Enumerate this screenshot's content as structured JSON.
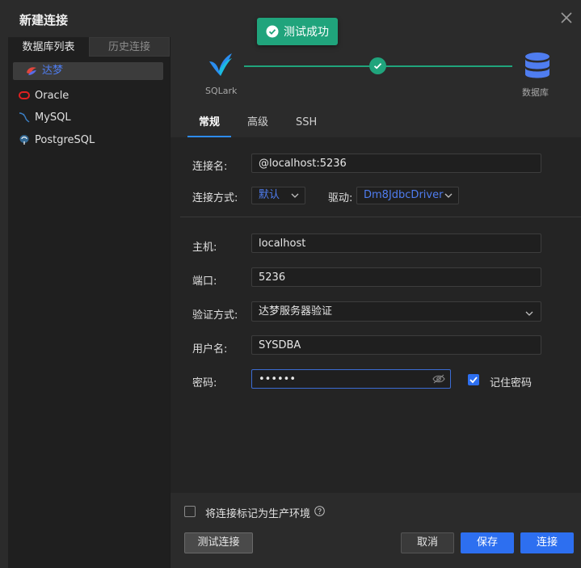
{
  "dialog": {
    "title": "新建连接"
  },
  "toast": {
    "text": "测试成功",
    "color": "#20a47c"
  },
  "left_panel": {
    "tabs": [
      {
        "label": "数据库列表",
        "active": true
      },
      {
        "label": "历史连接",
        "active": false
      }
    ],
    "items": [
      {
        "label": "达梦",
        "icon": "dameng-icon",
        "selected": true
      },
      {
        "label": "Oracle",
        "icon": "oracle-icon",
        "selected": false
      },
      {
        "label": "MySQL",
        "icon": "mysql-icon",
        "selected": false
      },
      {
        "label": "PostgreSQL",
        "icon": "postgresql-icon",
        "selected": false
      }
    ]
  },
  "progress": {
    "left_label": "SQLark",
    "right_label": "数据库",
    "step_done": true
  },
  "tabs": [
    {
      "label": "常规",
      "active": true
    },
    {
      "label": "高级",
      "active": false
    },
    {
      "label": "SSH",
      "active": false
    }
  ],
  "form": {
    "connection_name": {
      "label": "连接名:",
      "value": "@localhost:5236"
    },
    "connection_method": {
      "label": "连接方式:",
      "value": "默认"
    },
    "driver": {
      "label": "驱动:",
      "value": "Dm8JdbcDriver"
    },
    "host": {
      "label": "主机:",
      "value": "localhost"
    },
    "port": {
      "label": "端口:",
      "value": "5236"
    },
    "auth_method": {
      "label": "验证方式:",
      "value": "达梦服务器验证"
    },
    "username": {
      "label": "用户名:",
      "value": "SYSDBA"
    },
    "password": {
      "label": "密码:",
      "value": "••••••"
    },
    "remember_password": {
      "label": "记住密码",
      "checked": true
    }
  },
  "production_flag": {
    "label": "将连接标记为生产环境",
    "checked": false
  },
  "buttons": {
    "test": "测试连接",
    "cancel": "取消",
    "save": "保存",
    "connect": "连接"
  },
  "colors": {
    "accent": "#2d6ff0",
    "success": "#20a47c",
    "background": "#2b2b2b"
  }
}
